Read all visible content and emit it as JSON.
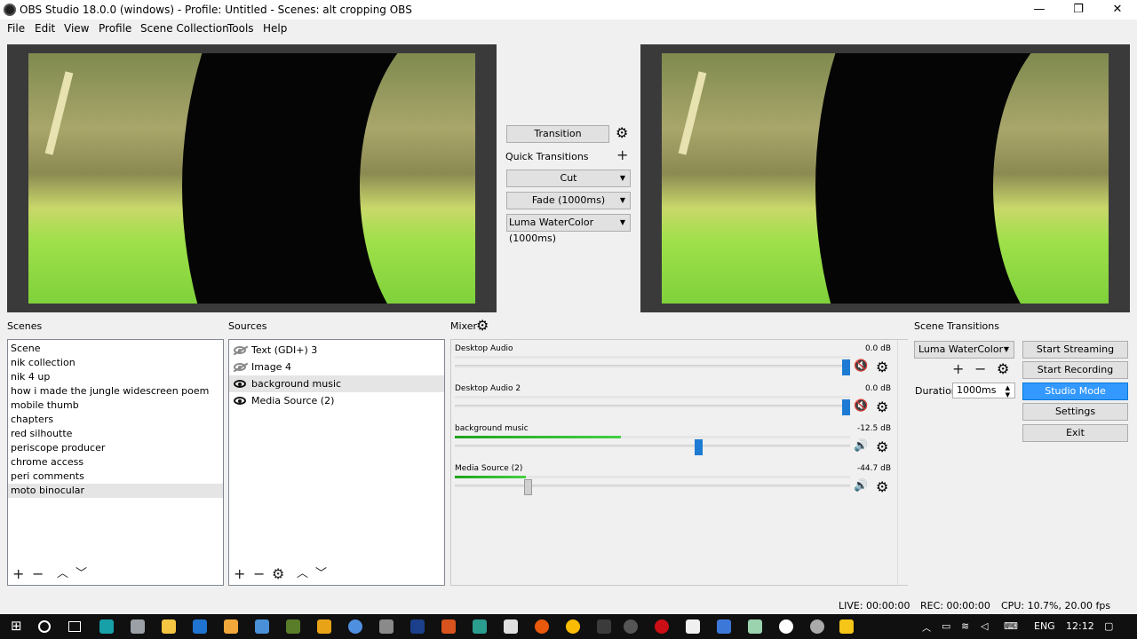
{
  "window": {
    "title": "OBS Studio 18.0.0 (windows) - Profile: Untitled - Scenes: alt cropping OBS",
    "minimize": "—",
    "maximize": "❐",
    "close": "✕"
  },
  "menu": [
    "File",
    "Edit",
    "View",
    "Profile",
    "Scene Collection",
    "Tools",
    "Help"
  ],
  "transition_panel": {
    "transition_button": "Transition",
    "quick_transitions_label": "Quick Transitions",
    "cut": "Cut",
    "fade": "Fade (1000ms)",
    "luma": "Luma WaterColor (1000ms)"
  },
  "scenes": {
    "title": "Scenes",
    "items": [
      "Scene",
      "nik collection",
      "nik 4 up",
      "how i made the jungle widescreen poem",
      "mobile thumb",
      "chapters",
      "red silhoutte",
      "periscope producer",
      "chrome access",
      "peri comments",
      "moto binocular"
    ],
    "selected": 10
  },
  "sources": {
    "title": "Sources",
    "items": [
      {
        "label": "Text (GDI+) 3",
        "visible": false
      },
      {
        "label": "Image 4",
        "visible": false
      },
      {
        "label": "background music",
        "visible": true
      },
      {
        "label": "Media Source (2)",
        "visible": true
      }
    ],
    "selected": 2
  },
  "mixer": {
    "title": "Mixer",
    "channels": [
      {
        "name": "Desktop Audio",
        "db": "0.0 dB",
        "muted": true,
        "level": 0.0,
        "volume": 1.0
      },
      {
        "name": "Desktop Audio 2",
        "db": "0.0 dB",
        "muted": true,
        "level": 0.0,
        "volume": 1.0
      },
      {
        "name": "background music",
        "db": "-12.5 dB",
        "muted": false,
        "level": 0.42,
        "volume": 0.62
      },
      {
        "name": "Media Source (2)",
        "db": "-44.7 dB",
        "muted": false,
        "level": 0.18,
        "volume": 0.18
      }
    ]
  },
  "scene_transitions": {
    "title": "Scene Transitions",
    "selected": "Luma WaterColor",
    "duration_label": "Duration",
    "duration_value": "1000ms"
  },
  "controls": {
    "start_streaming": "Start Streaming",
    "start_recording": "Start Recording",
    "studio_mode": "Studio Mode",
    "settings": "Settings",
    "exit": "Exit"
  },
  "status": {
    "live": "LIVE: 00:00:00",
    "rec": "REC: 00:00:00",
    "cpu": "CPU: 10.7%, 20.00 fps"
  },
  "taskbar": {
    "lang": "ENG",
    "time": "12:12"
  },
  "colors": {
    "accent": "#3399ff",
    "meter_green": "#2fbf2f",
    "fader_blue": "#1e7bd4",
    "mute_red": "#d0202a"
  }
}
